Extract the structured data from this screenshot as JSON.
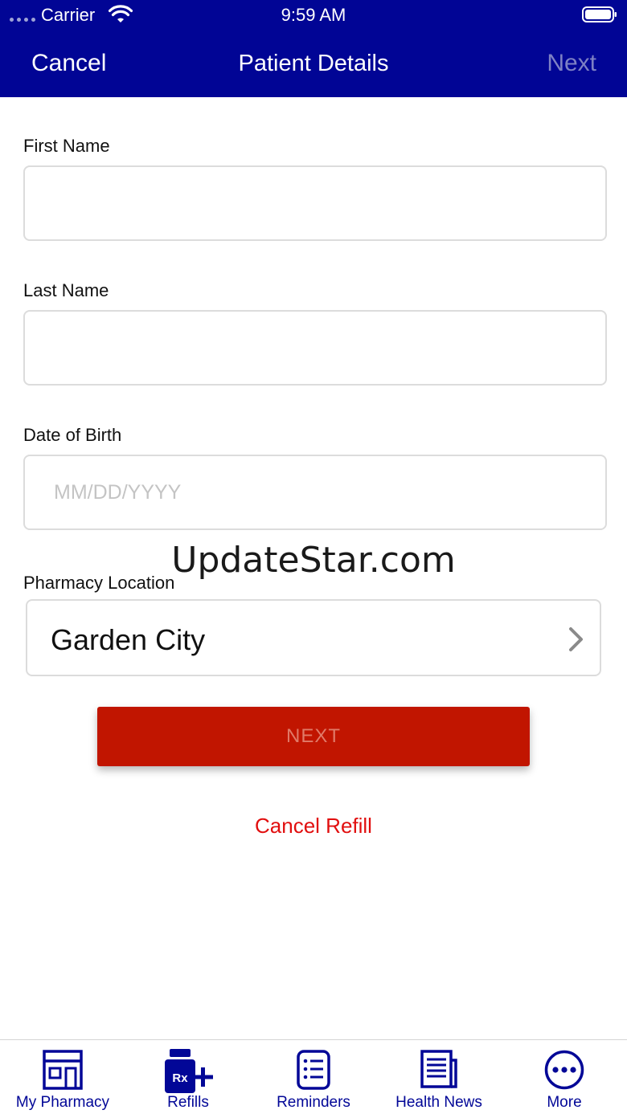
{
  "status_bar": {
    "carrier": "Carrier",
    "time": "9:59 AM"
  },
  "nav": {
    "cancel_label": "Cancel",
    "title": "Patient Details",
    "next_label": "Next"
  },
  "form": {
    "first_name": {
      "label": "First Name",
      "value": "",
      "placeholder": ""
    },
    "last_name": {
      "label": "Last Name",
      "value": "",
      "placeholder": ""
    },
    "dob": {
      "label": "Date of Birth",
      "value": "",
      "placeholder": "MM/DD/YYYY"
    },
    "pharmacy": {
      "label": "Pharmacy Location",
      "value": "Garden City"
    }
  },
  "watermark": "UpdateStar.com",
  "next_button_label": "NEXT",
  "cancel_refill_label": "Cancel Refill",
  "tabs": [
    {
      "label": "My Pharmacy",
      "icon": "pharmacy-store-icon"
    },
    {
      "label": "Refills",
      "icon": "rx-refill-icon"
    },
    {
      "label": "Reminders",
      "icon": "checklist-icon"
    },
    {
      "label": "Health News",
      "icon": "newspaper-icon"
    },
    {
      "label": "More",
      "icon": "more-dots-icon"
    }
  ],
  "colors": {
    "header_bg": "#010595",
    "tab_icon": "#020797",
    "next_button_bg": "#c11500",
    "cancel_refill_text": "#e10e0e",
    "disabled_nav_next": "#7e81c4"
  }
}
